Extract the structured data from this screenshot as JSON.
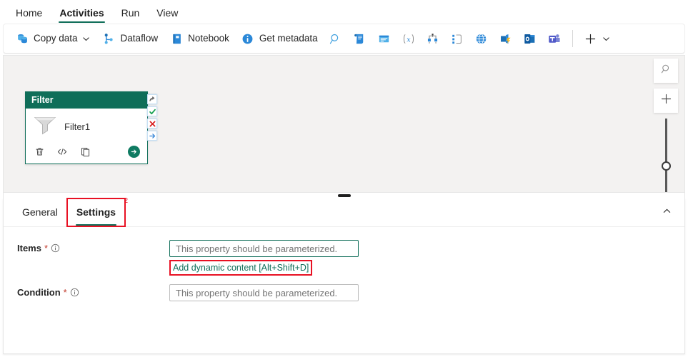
{
  "ribbon": {
    "tabs": [
      {
        "label": "Home",
        "active": false
      },
      {
        "label": "Activities",
        "active": true
      },
      {
        "label": "Run",
        "active": false
      },
      {
        "label": "View",
        "active": false
      }
    ]
  },
  "toolbar": {
    "items": [
      {
        "label": "Copy data",
        "icon": "copy-data-icon",
        "chevron": true
      },
      {
        "label": "Dataflow",
        "icon": "dataflow-icon",
        "chevron": false
      },
      {
        "label": "Notebook",
        "icon": "notebook-icon",
        "chevron": false
      },
      {
        "label": "Get metadata",
        "icon": "get-metadata-icon",
        "chevron": false
      }
    ],
    "icon_buttons": [
      {
        "name": "lookup-icon"
      },
      {
        "name": "script-icon"
      },
      {
        "name": "stored-procedure-icon"
      },
      {
        "name": "set-variable-icon"
      },
      {
        "name": "switch-icon"
      },
      {
        "name": "if-condition-icon"
      },
      {
        "name": "web-icon"
      },
      {
        "name": "azure-function-icon"
      },
      {
        "name": "outlook-icon"
      },
      {
        "name": "teams-icon"
      }
    ],
    "add_button": {
      "name": "add-activity-icon",
      "chevron": "chevron-down-icon"
    }
  },
  "canvas": {
    "activity": {
      "type": "Filter",
      "name": "Filter1",
      "icon": "filter-funnel-icon",
      "footer_buttons": [
        {
          "name": "delete-icon"
        },
        {
          "name": "code-view-icon"
        },
        {
          "name": "duplicate-icon"
        }
      ],
      "run_button": {
        "name": "run-arrow-icon"
      },
      "handles": [
        {
          "name": "on-skip-handle",
          "glyph": "skip"
        },
        {
          "name": "on-success-handle",
          "glyph": "check"
        },
        {
          "name": "on-failure-handle",
          "glyph": "cross"
        },
        {
          "name": "on-completion-handle",
          "glyph": "arrow"
        }
      ]
    },
    "controls": {
      "search": {
        "name": "canvas-search-icon"
      },
      "zoom_in": {
        "name": "zoom-in-icon"
      },
      "slider": {
        "name": "zoom-slider"
      }
    }
  },
  "properties": {
    "tabs": [
      {
        "label": "General",
        "active": false,
        "annotated": false
      },
      {
        "label": "Settings",
        "active": true,
        "annotated": true,
        "annotation_number": "2"
      }
    ],
    "collapse_icon": "chevron-up-icon",
    "fields": [
      {
        "label": "Items",
        "required": "*",
        "info": "info-icon",
        "placeholder": "This property should be parameterized.",
        "value": "",
        "focused": true,
        "dynamic_link": "Add dynamic content [Alt+Shift+D]",
        "dynamic_link_annotated": true
      },
      {
        "label": "Condition",
        "required": "*",
        "info": "info-icon",
        "placeholder": "This property should be parameterized.",
        "value": "",
        "focused": false,
        "dynamic_link": null,
        "dynamic_link_annotated": false
      }
    ]
  },
  "colors": {
    "accent_teal": "#0f6e59",
    "annotation_red": "#e81123",
    "canvas_bg": "#f3f2f1",
    "required_star": "#c1392b"
  }
}
